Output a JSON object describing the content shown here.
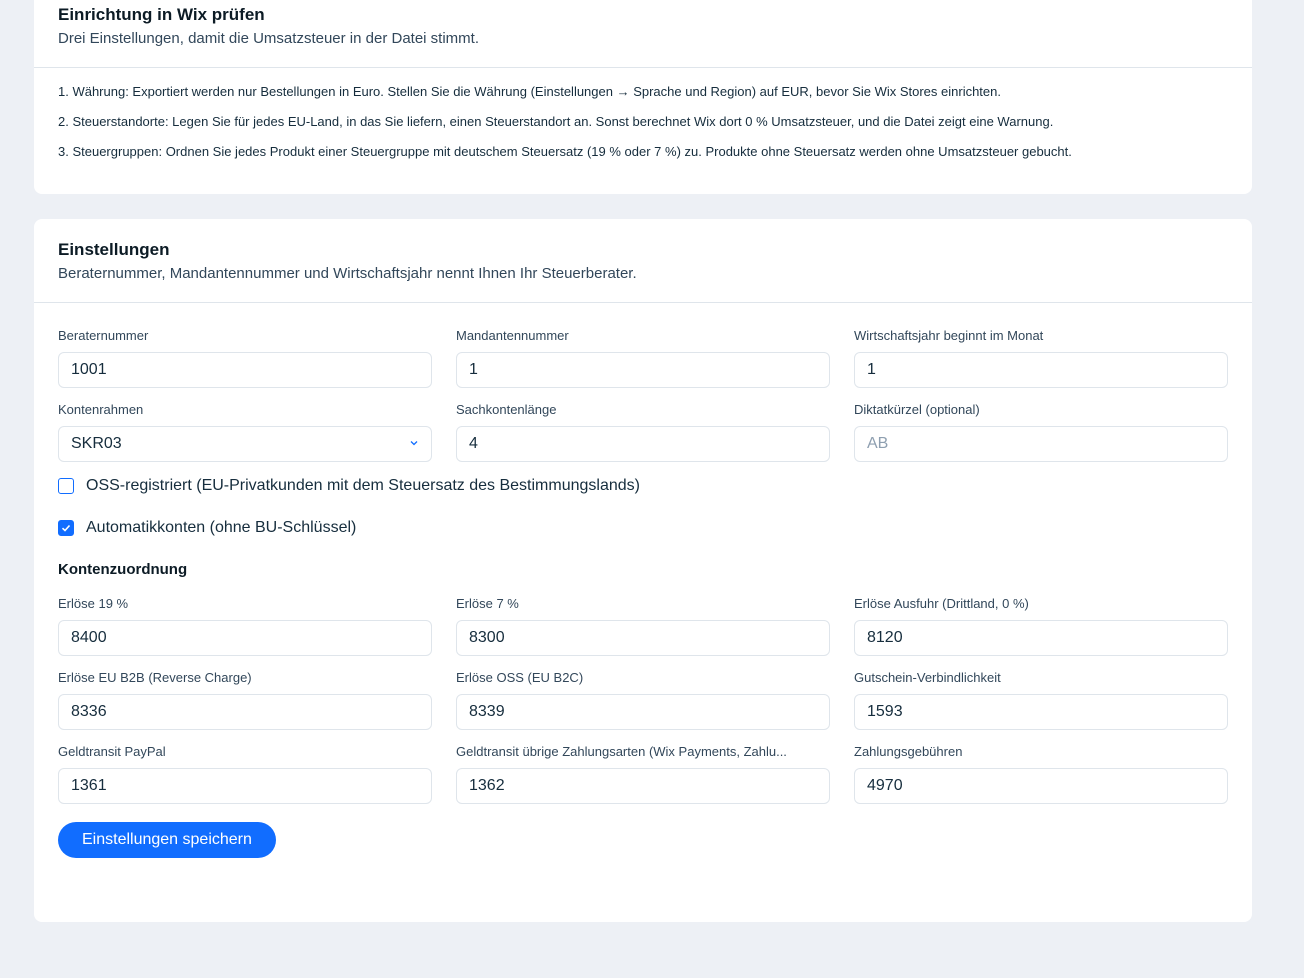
{
  "setup": {
    "title": "Einrichtung in Wix prüfen",
    "subtitle": "Drei Einstellungen, damit die Umsatzsteuer in der Datei stimmt.",
    "steps": [
      "1. Währung: Exportiert werden nur Bestellungen in Euro. Stellen Sie die Währung (Einstellungen → Sprache und Region) auf EUR, bevor Sie Wix Stores einrichten.",
      "2. Steuerstandorte: Legen Sie für jedes EU-Land, in das Sie liefern, einen Steuerstandort an. Sonst berechnet Wix dort 0 % Umsatzsteuer, und die Datei zeigt eine Warnung.",
      "3. Steuergruppen: Ordnen Sie jedes Produkt einer Steuergruppe mit deutschem Steuersatz (19 % oder 7 %) zu. Produkte ohne Steuersatz werden ohne Umsatzsteuer gebucht."
    ]
  },
  "settings": {
    "title": "Einstellungen",
    "subtitle": "Beraternummer, Mandantennummer und Wirtschaftsjahr nennt Ihnen Ihr Steuerberater.",
    "berater": {
      "label": "Beraternummer",
      "value": "1001"
    },
    "mandant": {
      "label": "Mandantennummer",
      "value": "1"
    },
    "wj": {
      "label": "Wirtschaftsjahr beginnt im Monat",
      "value": "1"
    },
    "kontenrahmen": {
      "label": "Kontenrahmen",
      "value": "SKR03"
    },
    "sachkonten": {
      "label": "Sachkontenlänge",
      "value": "4"
    },
    "diktat": {
      "label": "Diktatkürzel (optional)",
      "value": "",
      "placeholder": "AB"
    },
    "oss": {
      "label": "OSS-registriert (EU-Privatkunden mit dem Steuersatz des Bestimmungslands)",
      "checked": false
    },
    "auto": {
      "label": "Automatikkonten (ohne BU-Schlüssel)",
      "checked": true
    },
    "konten_title": "Kontenzuordnung",
    "konten": [
      {
        "label": "Erlöse 19 %",
        "value": "8400"
      },
      {
        "label": "Erlöse 7 %",
        "value": "8300"
      },
      {
        "label": "Erlöse Ausfuhr (Drittland, 0 %)",
        "value": "8120"
      },
      {
        "label": "Erlöse EU B2B (Reverse Charge)",
        "value": "8336"
      },
      {
        "label": "Erlöse OSS (EU B2C)",
        "value": "8339"
      },
      {
        "label": "Gutschein-Verbindlichkeit",
        "value": "1593"
      },
      {
        "label": "Geldtransit PayPal",
        "value": "1361"
      },
      {
        "label": "Geldtransit übrige Zahlungsarten (Wix Payments, Zahlu...",
        "value": "1362"
      },
      {
        "label": "Zahlungsgebühren",
        "value": "4970"
      }
    ],
    "save_label": "Einstellungen speichern"
  },
  "colors": {
    "accent": "#116dff",
    "background": "#edf0f5"
  }
}
